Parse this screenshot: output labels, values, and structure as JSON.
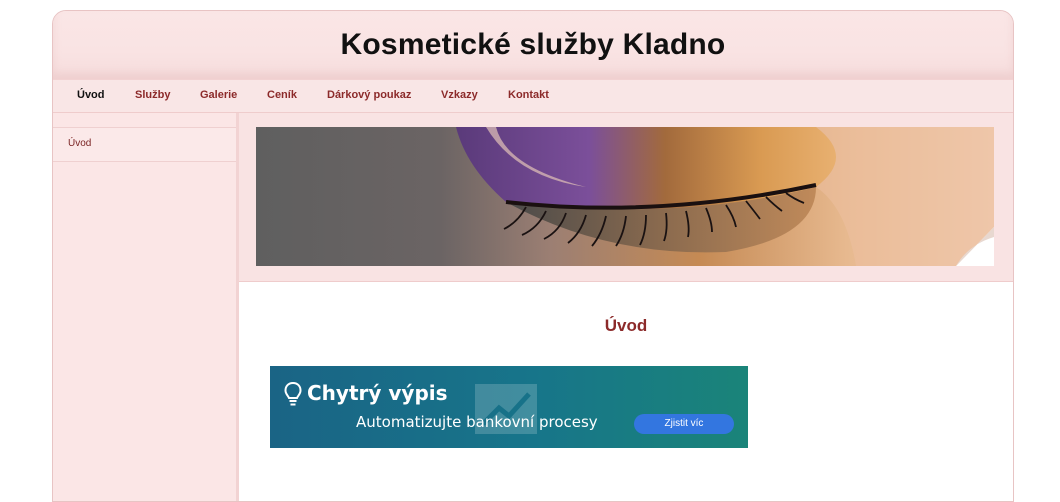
{
  "header": {
    "title": "Kosmetické služby Kladno"
  },
  "nav": {
    "items": [
      {
        "label": "Úvod",
        "active": true
      },
      {
        "label": "Služby"
      },
      {
        "label": "Galerie"
      },
      {
        "label": "Ceník"
      },
      {
        "label": "Dárkový poukaz"
      },
      {
        "label": "Vzkazy"
      },
      {
        "label": "Kontakt"
      }
    ]
  },
  "sidebar": {
    "items": [
      {
        "label": "Úvod"
      }
    ]
  },
  "main": {
    "title": "Úvod"
  },
  "ad": {
    "title": "Chytrý výpis",
    "subtitle": "Automatizujte bankovní procesy",
    "button_label": "Zjistit víc"
  },
  "colors": {
    "accent": "#8c2a2a",
    "background": "#fbeaea",
    "ad_button": "#3376e0"
  }
}
